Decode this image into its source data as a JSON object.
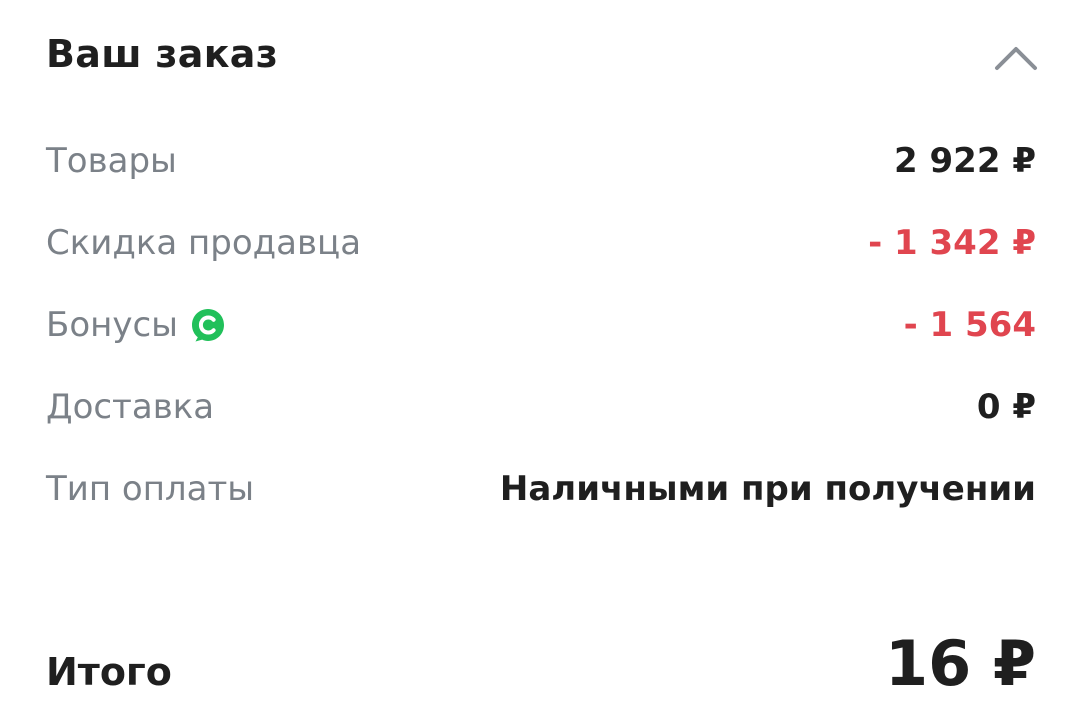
{
  "order_summary": {
    "title": "Ваш заказ",
    "collapse_icon": "chevron-up-icon",
    "rows": [
      {
        "label": "Товары",
        "value": "2 922 ₽"
      },
      {
        "label": "Скидка продавца",
        "value": "- 1 342 ₽"
      },
      {
        "label": "Бонусы",
        "value": "- 1 564",
        "icon": "bonus-coin-icon"
      },
      {
        "label": "Доставка",
        "value": "0 ₽"
      },
      {
        "label": "Тип оплаты",
        "value": "Наличными при получении"
      }
    ],
    "total": {
      "label": "Итого",
      "value": "16 ₽"
    }
  },
  "colors": {
    "text_primary": "#1f1f1f",
    "text_secondary": "#7b8188",
    "discount": "#e0454f",
    "bonus_green": "#21c05a",
    "chevron": "#8a8f96"
  }
}
